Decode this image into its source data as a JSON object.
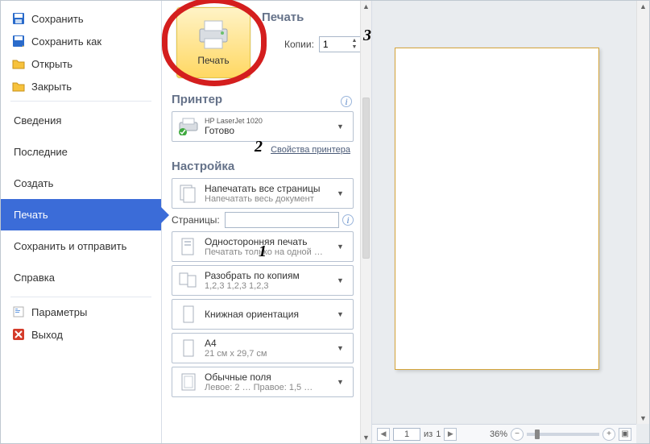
{
  "sidebar": {
    "small_items": [
      {
        "label": "Сохранить",
        "icon": "save"
      },
      {
        "label": "Сохранить как",
        "icon": "save-as"
      },
      {
        "label": "Открыть",
        "icon": "open"
      },
      {
        "label": "Закрыть",
        "icon": "close-doc"
      }
    ],
    "big_items": [
      {
        "label": "Сведения",
        "key": "info"
      },
      {
        "label": "Последние",
        "key": "recent"
      },
      {
        "label": "Создать",
        "key": "new"
      },
      {
        "label": "Печать",
        "key": "print",
        "active": true
      },
      {
        "label": "Сохранить и отправить",
        "key": "share"
      },
      {
        "label": "Справка",
        "key": "help"
      }
    ],
    "footer_items": [
      {
        "label": "Параметры",
        "icon": "options"
      },
      {
        "label": "Выход",
        "icon": "exit"
      }
    ]
  },
  "print": {
    "title": "Печать",
    "button_label": "Печать",
    "copies_label": "Копии:",
    "copies_value": "1",
    "printer_section": "Принтер",
    "printer_name": "HP LaserJet 1020",
    "printer_status": "Готово",
    "printer_props": "Свойства принтера",
    "settings_section": "Настройка",
    "pages_label": "Страницы:",
    "pages_value": "",
    "combos": [
      {
        "t1": "Напечатать все страницы",
        "t2": "Напечатать весь документ",
        "icon": "pages-all"
      },
      {
        "t1": "Односторонняя печать",
        "t2": "Печатать только на одной …",
        "icon": "single-side"
      },
      {
        "t1": "Разобрать по копиям",
        "t2": "1,2,3   1,2,3   1,2,3",
        "icon": "collate"
      },
      {
        "t1": "Книжная ориентация",
        "t2": "",
        "icon": "portrait"
      },
      {
        "t1": "A4",
        "t2": "21 см x 29,7 см",
        "icon": "page-size"
      },
      {
        "t1": "Обычные поля",
        "t2": "Левое: 2 …   Правое: 1,5 …",
        "icon": "margins"
      }
    ]
  },
  "preview": {
    "current_page": "1",
    "page_sep": "из",
    "total_pages": "1",
    "zoom": "36%"
  },
  "annotations": {
    "a1": "1",
    "a2": "2",
    "a3": "3"
  }
}
